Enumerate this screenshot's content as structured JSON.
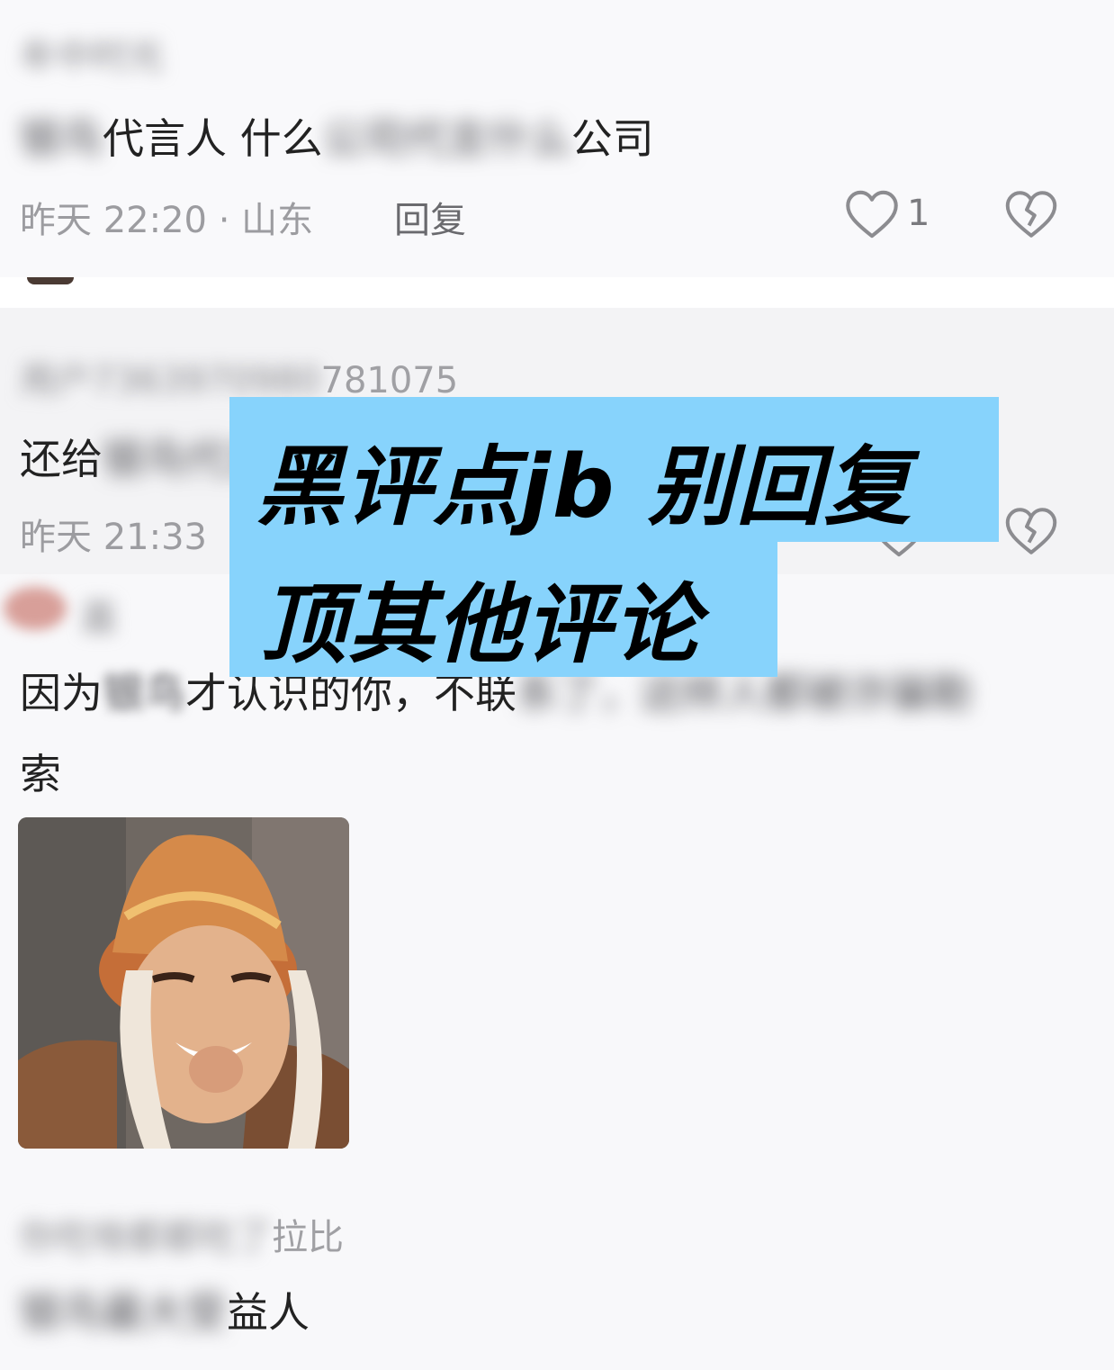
{
  "comments": [
    {
      "username": "牟中时光",
      "text_blurred_a": "银鸟",
      "text_visible_a": "代言人  什么",
      "text_blurred_b": "公司代言什么",
      "text_visible_b": "公司",
      "time_location": "昨天 22:20 · 山东",
      "reply_label": "回复",
      "like_count": "1"
    },
    {
      "username_blurred": "用户7363970980",
      "username_visible": "781075",
      "text_visible": "还给",
      "text_blurred": "银鸟代言",
      "time_location": "昨天 21:33"
    },
    {
      "username_blurred": "嘉",
      "text_line1_visible_a": "因为",
      "text_line1_blurred_a": "银鸟",
      "text_line1_visible_b": "才认识的你，不联",
      "text_line1_blurred_b": "系了，这样人都被诈骗勒",
      "text_line2": "索"
    },
    {
      "username_blurred": "你吃啥都都吃了",
      "username_visible": "拉比",
      "text_blurred": "银鸟最大受",
      "text_visible": "益人"
    }
  ],
  "overlay": {
    "line1": "黑评点jb 别回复",
    "line2": "顶其他评论",
    "background_color": "#87d3fc"
  },
  "icons": {
    "like": "heart-outline-icon",
    "dislike": "broken-heart-icon"
  }
}
